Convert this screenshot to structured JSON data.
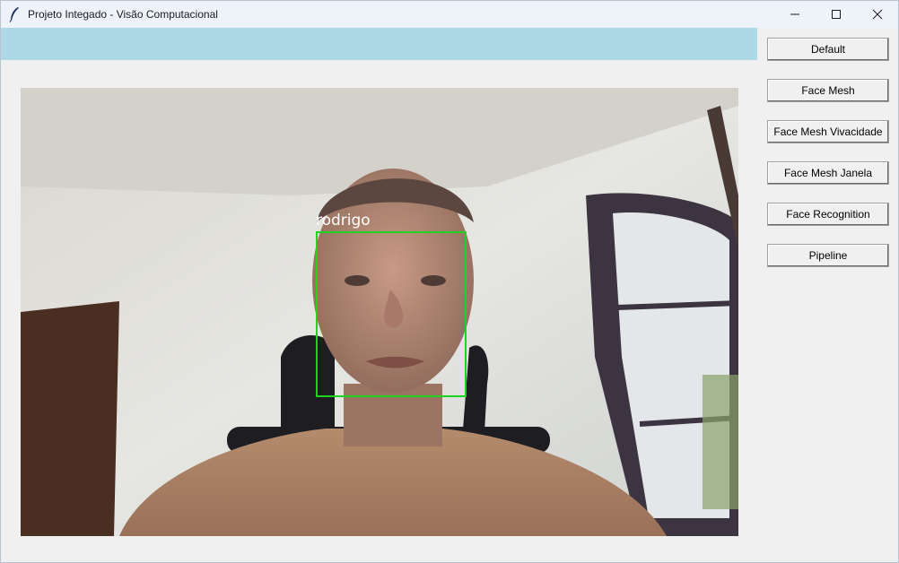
{
  "window": {
    "title": "Projeto Integado - Visão Computacional"
  },
  "video": {
    "detection_label": "rodrigo",
    "detection_box_color": "#1fd31f",
    "top_strip_color": "#add8e6"
  },
  "sidebar": {
    "buttons": [
      {
        "label": "Default"
      },
      {
        "label": "Face Mesh"
      },
      {
        "label": "Face Mesh Vivacidade"
      },
      {
        "label": "Face Mesh Janela"
      },
      {
        "label": "Face Recognition"
      },
      {
        "label": "Pipeline"
      }
    ]
  }
}
